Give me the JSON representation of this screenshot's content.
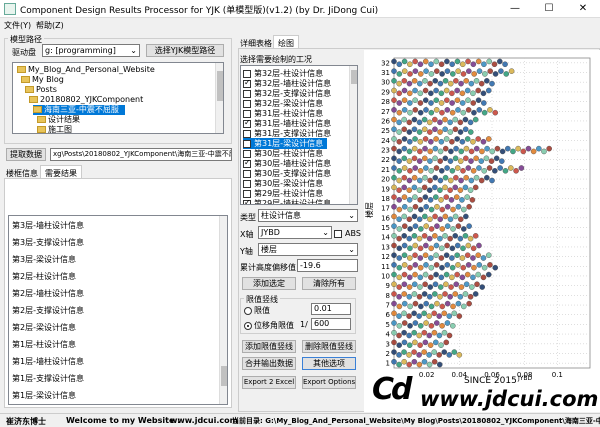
{
  "window": {
    "title": "Component Design Results Processor for YJK (单模型版)(v1.2) (by Dr. JiDong Cui)",
    "min": "—",
    "max": "☐",
    "close": "✕"
  },
  "menu": [
    "文件(Y)",
    "帮助(Z)"
  ],
  "left": {
    "group_label": "模型路径",
    "drive_label": "驱动盘",
    "drive_value": "g: [programming]",
    "select_button": "选择YJK模型路径",
    "tree": [
      {
        "label": "My_Blog_And_Personal_Website",
        "selected": false
      },
      {
        "label": "My Blog",
        "selected": false
      },
      {
        "label": "Posts",
        "selected": false
      },
      {
        "label": "20180802_YJKComponent",
        "selected": false
      },
      {
        "label": "海南三亚-中震不屈服",
        "selected": true
      },
      {
        "label": "设计结果",
        "selected": false
      },
      {
        "label": "施工图",
        "selected": false
      }
    ],
    "extract_button": "提取数据",
    "path_value": "xg\\Posts\\20180802_YJKComponent\\海南三亚-中震不屈服",
    "tabs": [
      "楼框信息",
      "需要结果"
    ],
    "results": [
      "第3层-墙柱设计信息",
      "第3层-支撑设计信息",
      "第3层-梁设计信息",
      "第2层-柱设计信息",
      "第2层-墙柱设计信息",
      "第2层-支撑设计信息",
      "第2层-梁设计信息",
      "第1层-柱设计信息",
      "第1层-墙柱设计信息",
      "第1层-支撑设计信息",
      "第1层-梁设计信息"
    ]
  },
  "middle": {
    "tabs": [
      "详细表格",
      "绘图"
    ],
    "list_title": "选择需要绘制的工况",
    "conditions": [
      {
        "label": "第32层-柱设计信息",
        "checked": false,
        "selected": false
      },
      {
        "label": "第32层-墙柱设计信息",
        "checked": true,
        "selected": false
      },
      {
        "label": "第32层-支撑设计信息",
        "checked": false,
        "selected": false
      },
      {
        "label": "第32层-梁设计信息",
        "checked": false,
        "selected": false
      },
      {
        "label": "第31层-柱设计信息",
        "checked": false,
        "selected": false
      },
      {
        "label": "第31层-墙柱设计信息",
        "checked": true,
        "selected": false
      },
      {
        "label": "第31层-支撑设计信息",
        "checked": false,
        "selected": false
      },
      {
        "label": "第31层-梁设计信息",
        "checked": false,
        "selected": true
      },
      {
        "label": "第30层-柱设计信息",
        "checked": false,
        "selected": false
      },
      {
        "label": "第30层-墙柱设计信息",
        "checked": true,
        "selected": false
      },
      {
        "label": "第30层-支撑设计信息",
        "checked": false,
        "selected": false
      },
      {
        "label": "第30层-梁设计信息",
        "checked": false,
        "selected": false
      },
      {
        "label": "第29层-柱设计信息",
        "checked": false,
        "selected": false
      },
      {
        "label": "第29层-墙柱设计信息",
        "checked": true,
        "selected": false
      }
    ],
    "type_label": "类型",
    "type_value": "柱设计信息",
    "x_label": "X轴",
    "x_value": "JYBD",
    "abs_label": "ABS",
    "y_label": "Y轴",
    "y_value": "楼层",
    "offset_label": "累计高度偏移值",
    "offset_value": "-19.6",
    "add_button": "添加选定",
    "clear_button": "清除所有",
    "limit_group": "限值竖线",
    "limit_label": "限值",
    "limit_value": "0.01",
    "drift_label": "位移角限值",
    "drift_prefix": "1/",
    "drift_value": "600",
    "add_limit_button": "添加限值竖线",
    "del_limit_button": "删除限值竖线",
    "merge_button": "合并输出数据",
    "other_button": "其他选项",
    "export_button": "Export 2 Excel",
    "export_options_button": "Export Options"
  },
  "chart_data": {
    "type": "scatter",
    "ylabel": "楼层",
    "xlabel": "",
    "yticks": [
      "1",
      "2",
      "3",
      "4",
      "5",
      "6",
      "7",
      "8",
      "9",
      "10",
      "11",
      "12",
      "13",
      "14",
      "15",
      "16",
      "17",
      "18",
      "19",
      "20",
      "21",
      "22",
      "23",
      "24",
      "25",
      "26",
      "27",
      "28",
      "29",
      "30",
      "31",
      "32"
    ],
    "xticks": [
      "0.02",
      "0.04",
      "0.06",
      "0.08",
      "0.1"
    ],
    "xlim": [
      0,
      0.12
    ],
    "ylim": [
      0.5,
      32.5
    ],
    "series_colors": [
      "#1f3d6b",
      "#2e6bab",
      "#2f9e7a",
      "#d8b24a",
      "#c8463a",
      "#7a3a8c",
      "#e07f2a",
      "#3a8ec2",
      "#7ec9a9",
      "#a33b2e"
    ],
    "rows": [
      {
        "floor": 32,
        "min": 0.0,
        "max": 0.068
      },
      {
        "floor": 31,
        "min": 0.0,
        "max": 0.072
      },
      {
        "floor": 30,
        "min": 0.0,
        "max": 0.06
      },
      {
        "floor": 29,
        "min": 0.0,
        "max": 0.058
      },
      {
        "floor": 28,
        "min": 0.0,
        "max": 0.055
      },
      {
        "floor": 27,
        "min": 0.0,
        "max": 0.062
      },
      {
        "floor": 26,
        "min": 0.0,
        "max": 0.05
      },
      {
        "floor": 25,
        "min": 0.0,
        "max": 0.047
      },
      {
        "floor": 24,
        "min": 0.0,
        "max": 0.058
      },
      {
        "floor": 23,
        "min": 0.0,
        "max": 0.095
      },
      {
        "floor": 22,
        "min": 0.0,
        "max": 0.066
      },
      {
        "floor": 21,
        "min": 0.0,
        "max": 0.078
      },
      {
        "floor": 20,
        "min": 0.0,
        "max": 0.06
      },
      {
        "floor": 19,
        "min": 0.0,
        "max": 0.05
      },
      {
        "floor": 18,
        "min": 0.0,
        "max": 0.048
      },
      {
        "floor": 17,
        "min": 0.0,
        "max": 0.046
      },
      {
        "floor": 16,
        "min": 0.0,
        "max": 0.044
      },
      {
        "floor": 15,
        "min": 0.0,
        "max": 0.046
      },
      {
        "floor": 14,
        "min": 0.0,
        "max": 0.05
      },
      {
        "floor": 13,
        "min": 0.0,
        "max": 0.052
      },
      {
        "floor": 12,
        "min": 0.0,
        "max": 0.058
      },
      {
        "floor": 11,
        "min": 0.0,
        "max": 0.062
      },
      {
        "floor": 10,
        "min": 0.0,
        "max": 0.058
      },
      {
        "floor": 9,
        "min": 0.0,
        "max": 0.054
      },
      {
        "floor": 8,
        "min": 0.0,
        "max": 0.05
      },
      {
        "floor": 7,
        "min": 0.0,
        "max": 0.046
      },
      {
        "floor": 6,
        "min": 0.0,
        "max": 0.04
      },
      {
        "floor": 5,
        "min": 0.0,
        "max": 0.036
      },
      {
        "floor": 4,
        "min": 0.0,
        "max": 0.034
      },
      {
        "floor": 3,
        "min": 0.0,
        "max": 0.032
      },
      {
        "floor": 2,
        "min": 0.0,
        "max": 0.04
      },
      {
        "floor": 1,
        "min": 0.0,
        "max": 0.028
      }
    ]
  },
  "watermark": {
    "logo_letters": "Cd",
    "since": "SINCE 2015",
    "since_sub": "JYBD",
    "url": "www.jdcui.com"
  },
  "status": {
    "author": "崔济东博士",
    "welcome": "Welcome to my Website :",
    "site": "www.jdcui.com",
    "current_dir": "当前目录: G:\\My_Blog_And_Personal_Website\\My Blog\\Posts\\20180802_YJKComponent\\海南三亚-中震不屈"
  }
}
